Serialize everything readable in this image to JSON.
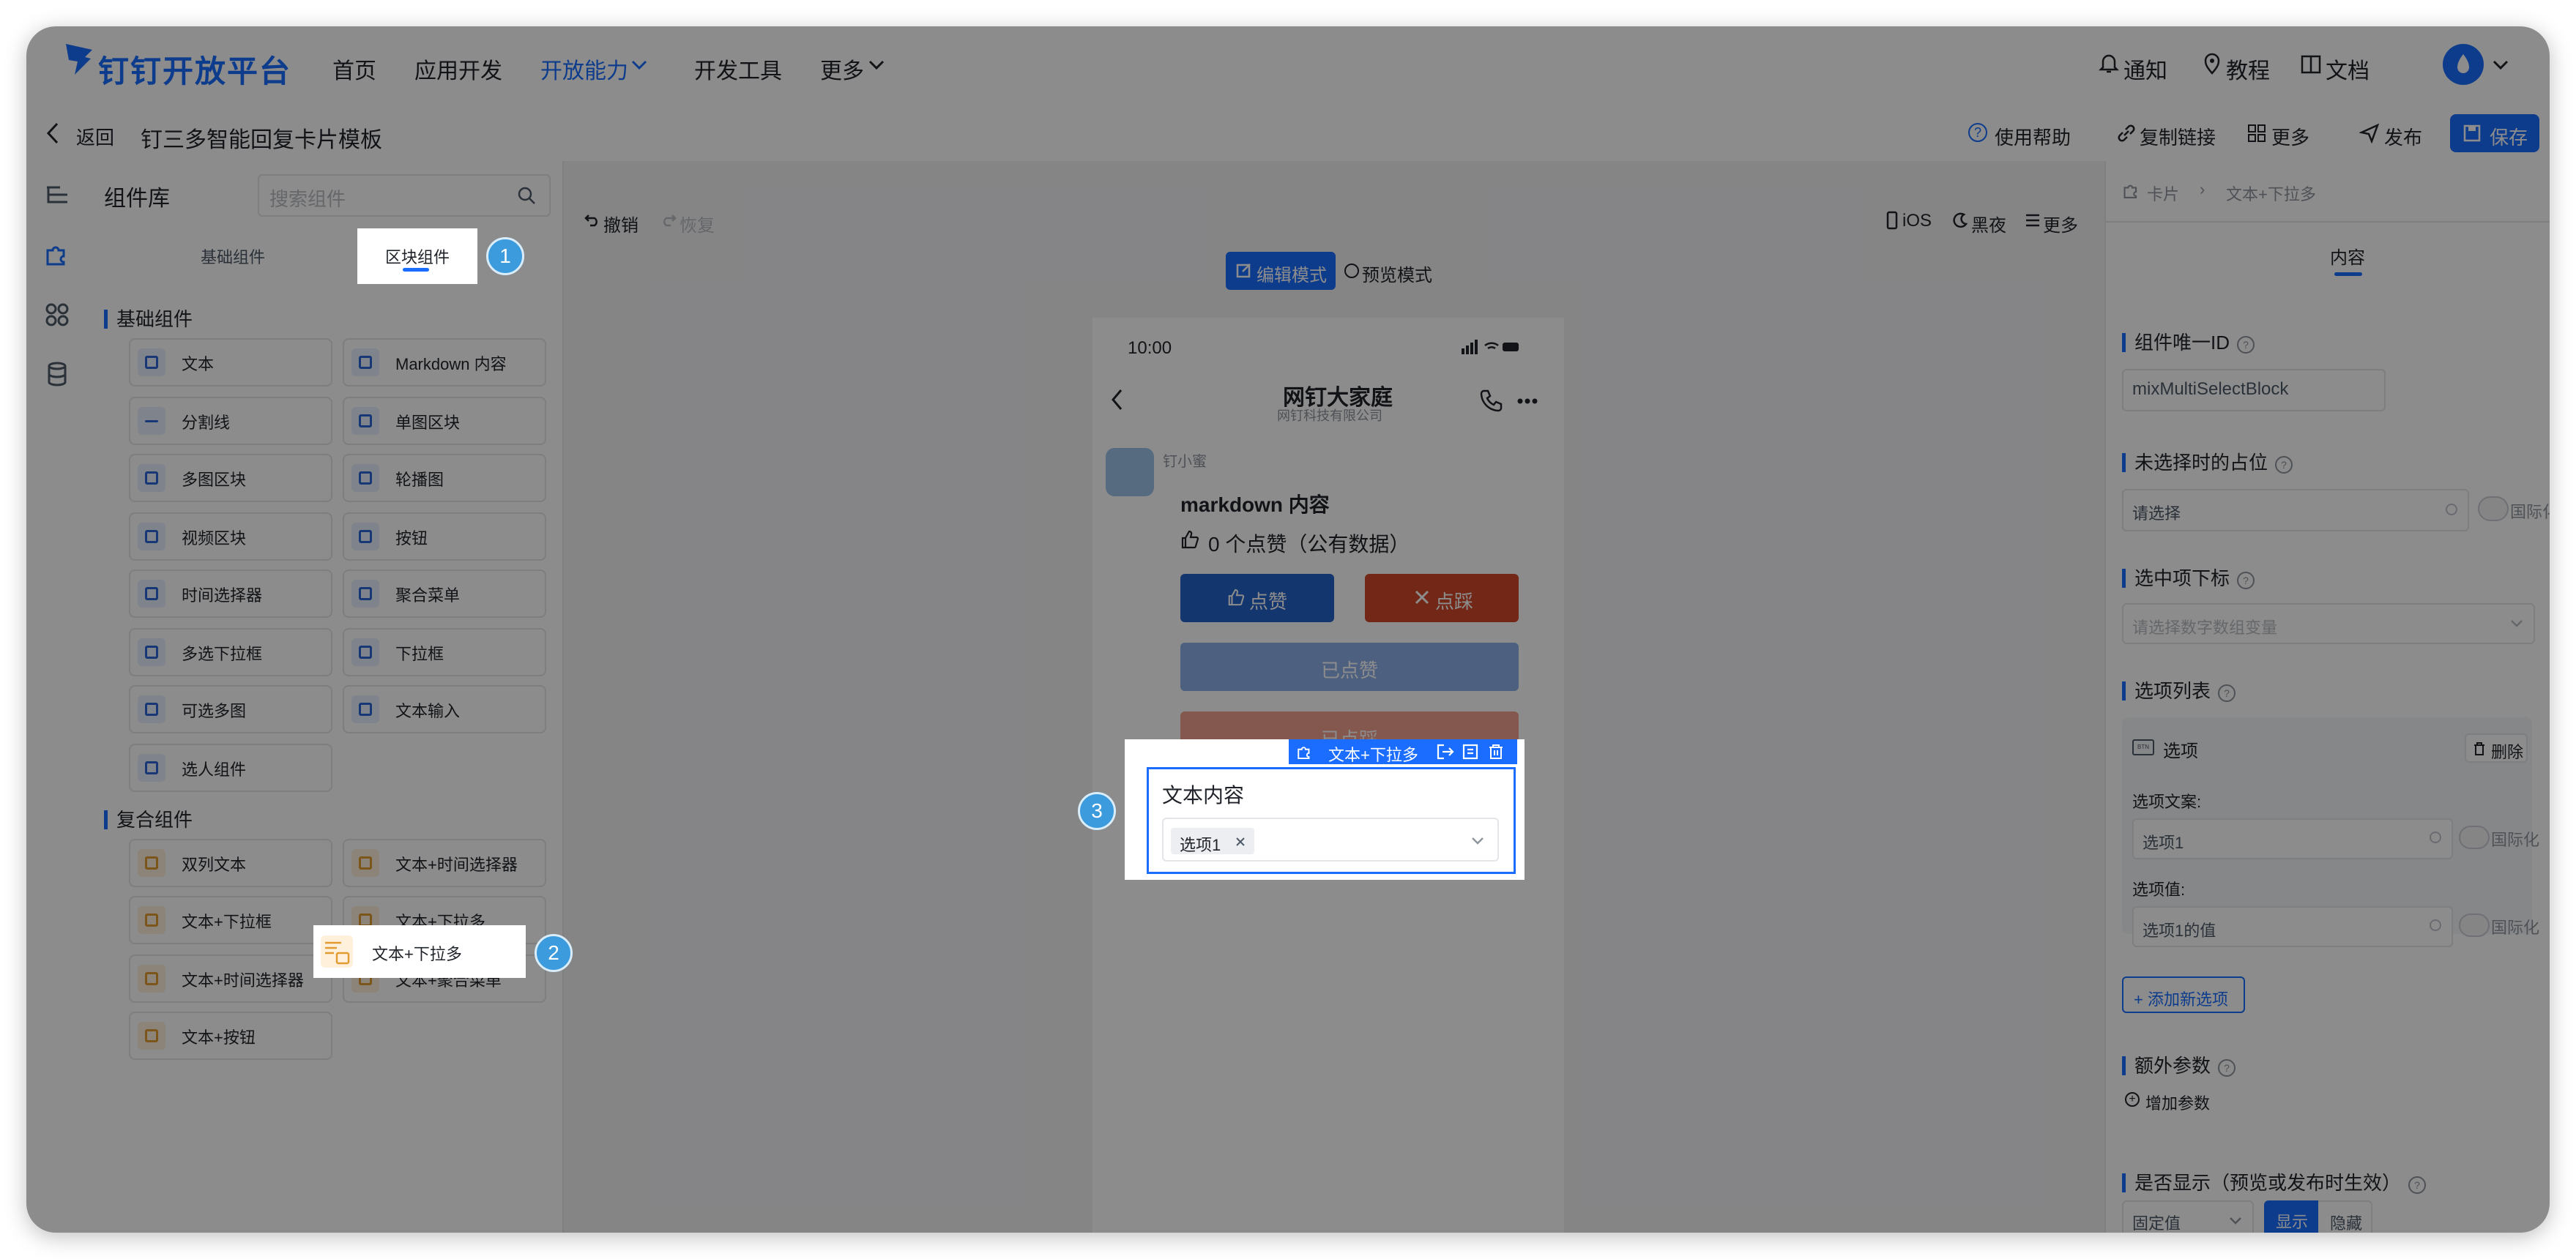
{
  "topnav": {
    "logo": "钉钉开放平台",
    "items": [
      "首页",
      "应用开发",
      "开放能力",
      "开发工具",
      "更多"
    ],
    "right": {
      "notify": "通知",
      "tutorial": "教程",
      "docs": "文档"
    }
  },
  "subheader": {
    "back": "返回",
    "title": "钉三多智能回复卡片模板",
    "help": "使用帮助",
    "copy_link": "复制链接",
    "more": "更多",
    "publish": "发布",
    "save": "保存"
  },
  "library": {
    "title": "组件库",
    "search_placeholder": "搜索组件",
    "tabs": [
      "基础组件",
      "区块组件"
    ],
    "basic_section": "基础组件",
    "basic": [
      "文本",
      "Markdown 内容",
      "分割线",
      "单图区块",
      "多图区块",
      "轮播图",
      "视频区块",
      "按钮",
      "时间选择器",
      "聚合菜单",
      "多选下拉框",
      "下拉框",
      "可选多图",
      "文本输入",
      "选人组件"
    ],
    "composite_section": "复合组件",
    "composite": [
      "双列文本",
      "文本+时间选择器",
      "文本+下拉框",
      "文本+下拉多",
      "文本+时间选择器",
      "文本+聚合菜单",
      "文本+按钮"
    ]
  },
  "toolbar": {
    "undo": "撤销",
    "redo": "恢复",
    "ios": "iOS",
    "dark": "黑夜",
    "more": "更多"
  },
  "modes": {
    "edit": "编辑模式",
    "preview": "预览模式"
  },
  "phone": {
    "time": "10:00",
    "chat_title": "网钉大家庭",
    "chat_subtitle": "网钉科技有限公司",
    "sender": "钉小蜜",
    "markdown": "markdown 内容",
    "likes": "0 个点赞（公有数据）",
    "like_btn": "点赞",
    "dislike_btn": "点踩",
    "liked_btn": "已点赞",
    "disliked_btn": "已点踩"
  },
  "selected_block": {
    "tag": "文本+下拉多",
    "title": "文本内容",
    "chip": "选项1"
  },
  "badges": [
    "1",
    "2",
    "3"
  ],
  "right_panel": {
    "breadcrumb": [
      "卡片",
      "文本+下拉多"
    ],
    "tab": "内容",
    "id_label": "组件唯一ID",
    "id_value": "mixMultiSelectBlock",
    "placeholder_label": "未选择时的占位",
    "placeholder_value": "请选择",
    "i18n": "国际化",
    "index_label": "选中项下标",
    "index_placeholder": "请选择数字数组变量",
    "options_label": "选项列表",
    "option_name": "选项",
    "delete": "删除",
    "option_text_label": "选项文案:",
    "option_text_value": "选项1",
    "option_value_label": "选项值:",
    "option_value_value": "选项1的值",
    "add_option": "+ 添加新选项",
    "extra_label": "额外参数",
    "add_param": "增加参数",
    "visible_label": "是否显示（预览或发布时生效）",
    "visible_select": "固定值",
    "show": "显示",
    "hide": "隐藏"
  },
  "colors": {
    "accent": "#1a6dff",
    "like": "#2563c8",
    "dislike": "#d1492b",
    "badge": "#3c9bdc"
  }
}
